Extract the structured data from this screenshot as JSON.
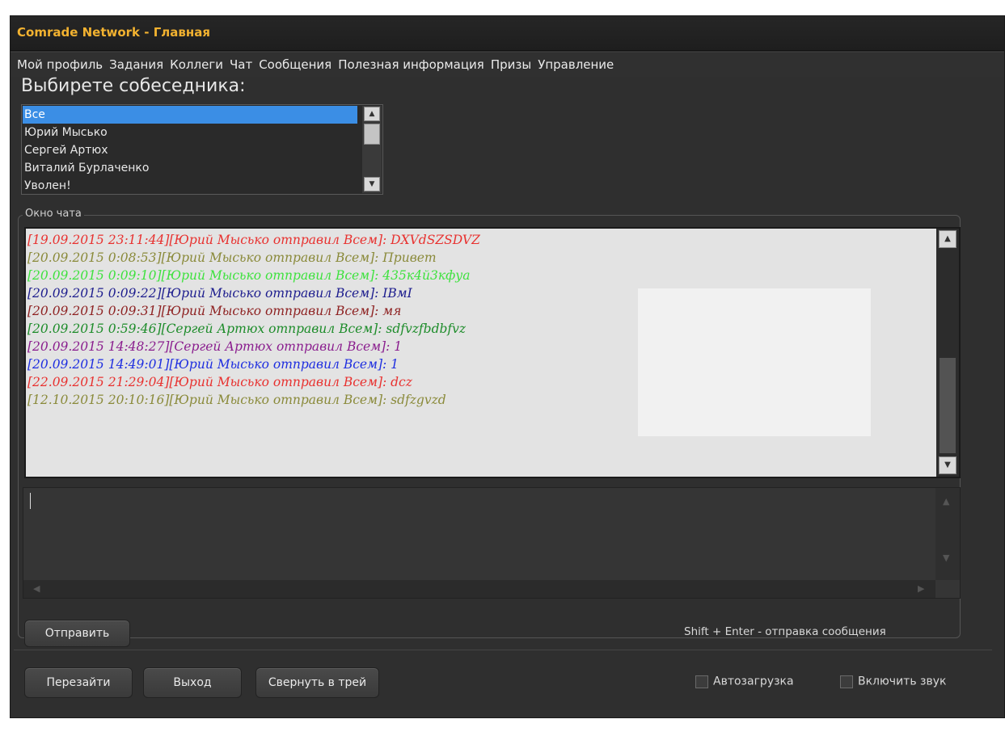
{
  "window": {
    "title": "Comrade Network - Главная"
  },
  "menu": {
    "items": [
      "Мой профиль",
      "Задания",
      "Коллеги",
      "Чат",
      "Сообщения",
      "Полезная информация",
      "Призы",
      "Управление"
    ]
  },
  "contacts": {
    "heading": "Выбирете собеседника:",
    "items": [
      "Все",
      "Юрий Мысько",
      "Сергей Артюх",
      "Виталий Бурлаченко",
      "Уволен!"
    ],
    "selected_index": 0
  },
  "chat": {
    "group_label": "Окно чата",
    "messages": [
      {
        "text": "[19.09.2015 23:11:44][Юрий Мысько отправил Всем]: DXVdSZSDVZ",
        "color": "#e8312f"
      },
      {
        "text": "[20.09.2015 0:08:53][Юрий Мысько отправил Всем]: Привет",
        "color": "#8a8a3a"
      },
      {
        "text": "[20.09.2015 0:09:10][Юрий Мысько отправил Всем]: 435к4й3кфуа",
        "color": "#3ee23e"
      },
      {
        "text": "[20.09.2015 0:09:22][Юрий Мысько отправил Всем]: IBмI",
        "color": "#1d1d8e"
      },
      {
        "text": "[20.09.2015 0:09:31][Юрий Мысько отправил Всем]: мя",
        "color": "#8e2222"
      },
      {
        "text": "[20.09.2015 0:59:46][Сергей Артюх отправил Всем]: sdfvzfbdbfvz",
        "color": "#1d8c2a"
      },
      {
        "text": "[20.09.2015 14:48:27][Сергей Артюх отправил Всем]: 1",
        "color": "#8a1d8e"
      },
      {
        "text": "[20.09.2015 14:49:01][Юрий Мысько отправил Всем]: 1",
        "color": "#1e2ee0"
      },
      {
        "text": "[22.09.2015 21:29:04][Юрий Мысько отправил Всем]: dcz",
        "color": "#e8312f"
      },
      {
        "text": "[12.10.2015 20:10:16][Юрий Мысько отправил Всем]: sdfzgvzd",
        "color": "#8a8a3a"
      }
    ]
  },
  "input": {
    "value": ""
  },
  "send": {
    "label": "Отправить",
    "hint": "Shift + Enter - отправка сообщения"
  },
  "footer": {
    "relogin_label": "Перезайти",
    "exit_label": "Выход",
    "tray_label": "Свернуть в трей",
    "autoload_label": "Автозагрузка",
    "sound_label": "Включить звук"
  },
  "icons": {
    "scroll_up": "triangle-up-icon",
    "scroll_down": "triangle-down-icon",
    "scroll_left": "triangle-left-icon",
    "scroll_right": "triangle-right-icon"
  },
  "colors": {
    "title": "#f2b230",
    "selection": "#3b8ee5"
  }
}
